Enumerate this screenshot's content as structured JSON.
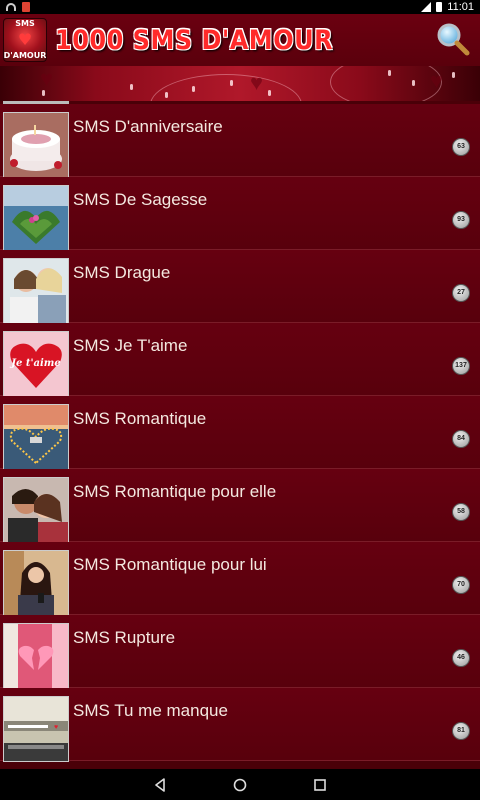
{
  "status": {
    "time": "11:01"
  },
  "app": {
    "title": "1000 SMS D'AMOUR",
    "logo_top": "SMS",
    "logo_bottom": "D'AMOUR"
  },
  "categories": [
    {
      "label": "SMS D'anniversaire",
      "count": "63",
      "thumb": "birthday-cake"
    },
    {
      "label": "SMS De Sagesse",
      "count": "93",
      "thumb": "heart-shaped-lake"
    },
    {
      "label": "SMS Drague",
      "count": "27",
      "thumb": "two-women"
    },
    {
      "label": "SMS Je T'aime",
      "count": "137",
      "thumb": "je-taime-heart",
      "thumb_text": "Je t'aime"
    },
    {
      "label": "SMS Romantique",
      "count": "84",
      "thumb": "heart-candles-beach"
    },
    {
      "label": "SMS Romantique pour elle",
      "count": "58",
      "thumb": "couple-hug"
    },
    {
      "label": "SMS Romantique pour lui",
      "count": "70",
      "thumb": "woman-phone"
    },
    {
      "label": "SMS Rupture",
      "count": "46",
      "thumb": "broken-heart"
    },
    {
      "label": "SMS Tu me manque",
      "count": "81",
      "thumb": "desk-note"
    }
  ],
  "colors": {
    "background": "#4a0008",
    "row": "#600010",
    "title": "#ff2a2a",
    "text": "#f4e8e0"
  }
}
